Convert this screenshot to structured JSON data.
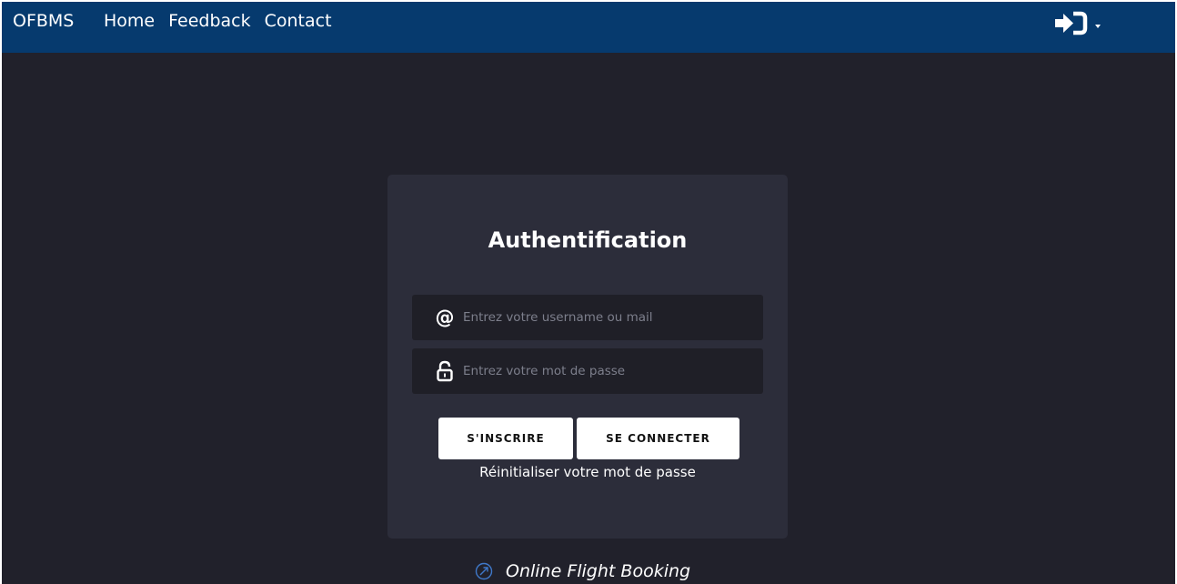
{
  "navbar": {
    "brand": "OFBMS",
    "links": [
      "Home",
      "Feedback",
      "Contact"
    ],
    "login_icon": "sign-in-icon"
  },
  "login_form": {
    "title": "Authentification",
    "username": {
      "icon": "at-icon",
      "placeholder": "Entrez votre username ou mail",
      "value": ""
    },
    "password": {
      "icon": "lock-icon",
      "placeholder": "Entrez votre mot de passe",
      "value": ""
    },
    "signup_label": "S'INSCRIRE",
    "login_label": "SE CONNECTER",
    "reset_link": "Réinitialiser votre mot de passe"
  },
  "footer": {
    "icon": "compass-icon",
    "text": "Online Flight Booking"
  },
  "colors": {
    "navbar": "#063a6e",
    "background": "#21212b",
    "card": "#2c2d3a",
    "input": "#1f1f27",
    "button": "#ffffff",
    "footer_icon": "#3f78c9"
  }
}
